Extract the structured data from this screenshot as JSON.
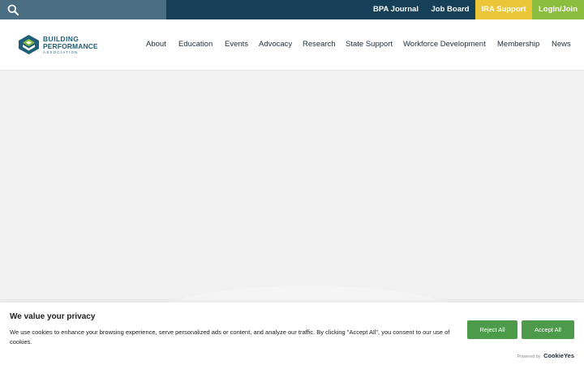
{
  "topbar": {
    "links": [
      {
        "label": "BPA Journal"
      },
      {
        "label": "Job Board"
      },
      {
        "label": "IRA Support"
      },
      {
        "label": "Login/Join"
      }
    ]
  },
  "logo": {
    "line1": "BUILDING",
    "line2": "PERFORMANCE",
    "line3": "ASSOCIATION"
  },
  "nav": {
    "items": [
      {
        "label": "About"
      },
      {
        "label": "Education"
      },
      {
        "label": "Events"
      },
      {
        "label": "Advocacy"
      },
      {
        "label": "Research"
      },
      {
        "label": "State Support"
      },
      {
        "label": "Workforce Development"
      },
      {
        "label": "Membership"
      },
      {
        "label": "News"
      }
    ]
  },
  "cookie": {
    "title": "We value your privacy",
    "text": "We use cookies to enhance your browsing experience, serve personalized ads or content, and analyze our traffic. By clicking \"Accept All\", you consent to our use of cookies.",
    "reject_label": "Reject All",
    "accept_label": "Accept All",
    "powered_by": "Powered by",
    "brand": "CookieYes"
  },
  "colors": {
    "topbar": "#163f58",
    "search_zone": "#4b6d82",
    "ira_support": "#e9c537",
    "login_join": "#8bbd3f",
    "cookie_buttons": "#4e9a4b"
  },
  "icons": [
    "search-icon",
    "bpa-logo-icon"
  ]
}
